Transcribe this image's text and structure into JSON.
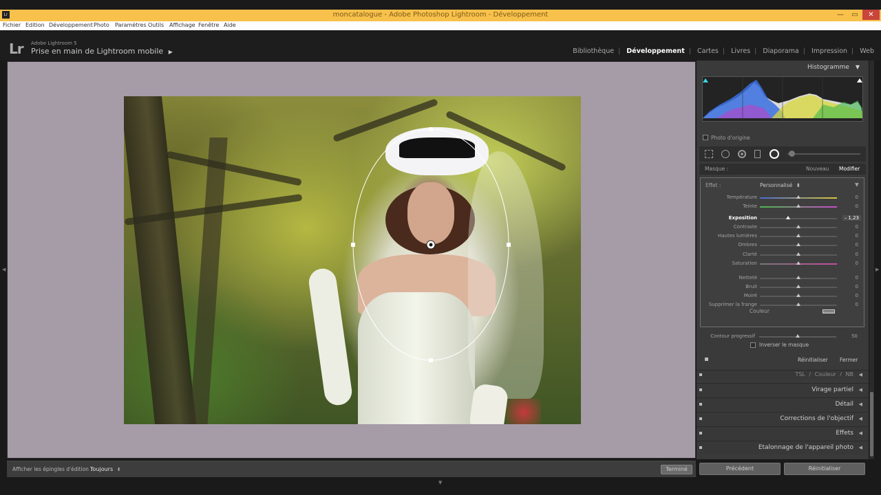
{
  "window": {
    "title": "moncatalogue - Adobe Photoshop Lightroom - Développement",
    "app_icon": "Lr",
    "minimize": "—",
    "maximize": "▭",
    "close": "✕"
  },
  "menu": [
    "Fichier",
    "Edition",
    "Développement",
    "Photo",
    "Paramètres",
    "Outils",
    "Affichage",
    "Fenêtre",
    "Aide"
  ],
  "identity": {
    "logo": "Lr",
    "product": "Adobe Lightroom 5",
    "title": "Prise en main de Lightroom mobile",
    "arrow": "▶"
  },
  "modules": [
    "Bibliothèque",
    "Développement",
    "Cartes",
    "Livres",
    "Diaporama",
    "Impression",
    "Web"
  ],
  "modules_active": "Développement",
  "toolbar": {
    "label": "Afficher les épingles d'édition :",
    "value": "Toujours",
    "value_arrow": "⬍",
    "done": "Terminé"
  },
  "panel": {
    "histogram_title": "Histogramme",
    "histogram_arrow": "▼",
    "original_photo": "Photo d'origine",
    "mask_label": "Masque :",
    "mask_new": "Nouveau",
    "mask_edit": "Modifier",
    "effect_label": "Effet :",
    "effect_value": "Personnalisé",
    "effect_value_arrow": "⬍",
    "effect_collapse": "▼",
    "sliders_a": [
      {
        "label": "Température",
        "value": "0",
        "pos": 0.5,
        "gradient": "linear-gradient(90deg,#4a6bd0,#d8c63c)"
      },
      {
        "label": "Teinte",
        "value": "0",
        "pos": 0.5,
        "gradient": "linear-gradient(90deg,#4cba4c,#c84cc8)"
      }
    ],
    "exposure": {
      "label": "Exposition",
      "value": "– 1,23",
      "pos": 0.37
    },
    "sliders_b": [
      {
        "label": "Contraste",
        "value": "0",
        "pos": 0.5
      },
      {
        "label": "Hautes lumières",
        "value": "0",
        "pos": 0.5
      },
      {
        "label": "Ombres",
        "value": "0",
        "pos": 0.5
      },
      {
        "label": "Clarté",
        "value": "0",
        "pos": 0.5
      },
      {
        "label": "Saturation",
        "value": "0",
        "pos": 0.5,
        "gradient": "linear-gradient(90deg,#777,#c84ca0)"
      }
    ],
    "sliders_c": [
      {
        "label": "Netteté",
        "value": "0",
        "pos": 0.5
      },
      {
        "label": "Bruit",
        "value": "0",
        "pos": 0.5
      },
      {
        "label": "Moiré",
        "value": "0",
        "pos": 0.5
      },
      {
        "label": "Supprimer la frange",
        "value": "0",
        "pos": 0.5
      }
    ],
    "color_label": "Couleur",
    "feather": {
      "label": "Contour progressif",
      "value": "50",
      "pos": 0.5
    },
    "invert_label": "Inverser le masque",
    "reset": "Réinitialiser",
    "close": "Fermer",
    "hsl_tabs": [
      "TSL",
      "/",
      "Couleur",
      "/",
      "NB"
    ],
    "sections": [
      "Virage partiel",
      "Détail",
      "Corrections de l'objectif",
      "Effets",
      "Etalonnage de l'appareil photo"
    ],
    "section_arrow": "◀",
    "prev": "Précédent",
    "reset_all": "Réinitialiser"
  },
  "colors": {
    "title_bar": "#f8c14b",
    "canvas_bg": "#a59ca8",
    "panel_bg": "#3a3a3a"
  }
}
